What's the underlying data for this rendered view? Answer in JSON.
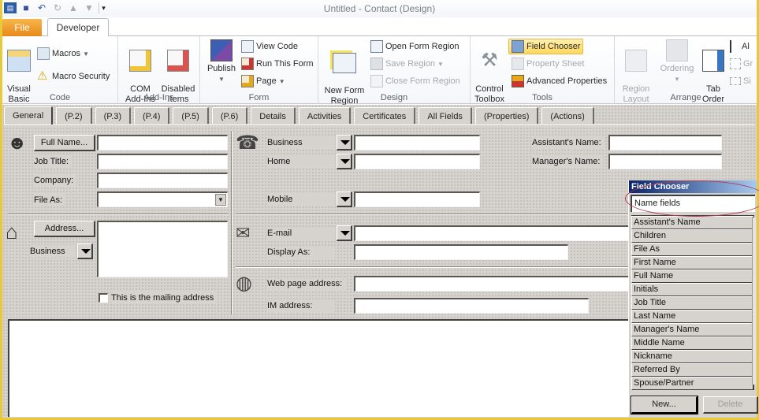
{
  "window": {
    "title": "Untitled  -  Contact   (Design)"
  },
  "quick_access": [
    {
      "icon": "outlook-icon"
    },
    {
      "icon": "save-icon"
    },
    {
      "icon": "undo-icon"
    },
    {
      "icon": "redo-icon"
    },
    {
      "icon": "up-arrow-icon"
    },
    {
      "icon": "down-arrow-icon"
    },
    {
      "icon": "customize-qat-icon"
    }
  ],
  "ribbon_tabs": {
    "file": "File",
    "developer": "Developer"
  },
  "ribbon": {
    "code": {
      "label": "Code",
      "visual_basic": "Visual\nBasic",
      "macros": "Macros",
      "macro_security": "Macro Security"
    },
    "addins": {
      "label": "Add-Ins",
      "com": "COM\nAdd-Ins",
      "disabled": "Disabled\nItems"
    },
    "form": {
      "label": "Form",
      "publish": "Publish",
      "view_code": "View Code",
      "run_form": "Run This Form",
      "page": "Page"
    },
    "design": {
      "label": "Design",
      "new_region": "New Form\nRegion",
      "open_region": "Open Form Region",
      "save_region": "Save Region",
      "close_region": "Close Form Region"
    },
    "tools": {
      "label": "Tools",
      "control_toolbox": "Control\nToolbox",
      "field_chooser": "Field Chooser",
      "property_sheet": "Property Sheet",
      "advanced_properties": "Advanced Properties"
    },
    "arrange": {
      "label": "Arrange",
      "region_layout": "Region\nLayout",
      "ordering": "Ordering",
      "tab_order": "Tab\nOrder",
      "align": "Al",
      "group": "Gr",
      "size": "Si"
    }
  },
  "form_tabs": [
    "General",
    "(P.2)",
    "(P.3)",
    "(P.4)",
    "(P.5)",
    "(P.6)",
    "Details",
    "Activities",
    "Certificates",
    "All Fields",
    "(Properties)",
    "(Actions)"
  ],
  "general": {
    "full_name_button": "Full Name...",
    "job_title": "Job Title:",
    "company": "Company:",
    "file_as": "File As:",
    "phone_business": "Business",
    "phone_home": "Home",
    "phone_mobile": "Mobile",
    "assistant_name": "Assistant's Name:",
    "manager_name": "Manager's Name:",
    "address_button": "Address...",
    "address_type": "Business",
    "mailing_address": "This is the mailing address",
    "email": "E-mail",
    "display_as": "Display As:",
    "web_page": "Web page address:",
    "im_address": "IM address:"
  },
  "field_chooser": {
    "title": "Field Chooser",
    "category": "Name fields",
    "items": [
      "Assistant's Name",
      "Children",
      "File As",
      "First Name",
      "Full Name",
      "Initials",
      "Job Title",
      "Last Name",
      "Manager's Name",
      "Middle Name",
      "Nickname",
      "Referred By",
      "Spouse/Partner"
    ],
    "new_button": "New...",
    "delete_button": "Delete"
  }
}
